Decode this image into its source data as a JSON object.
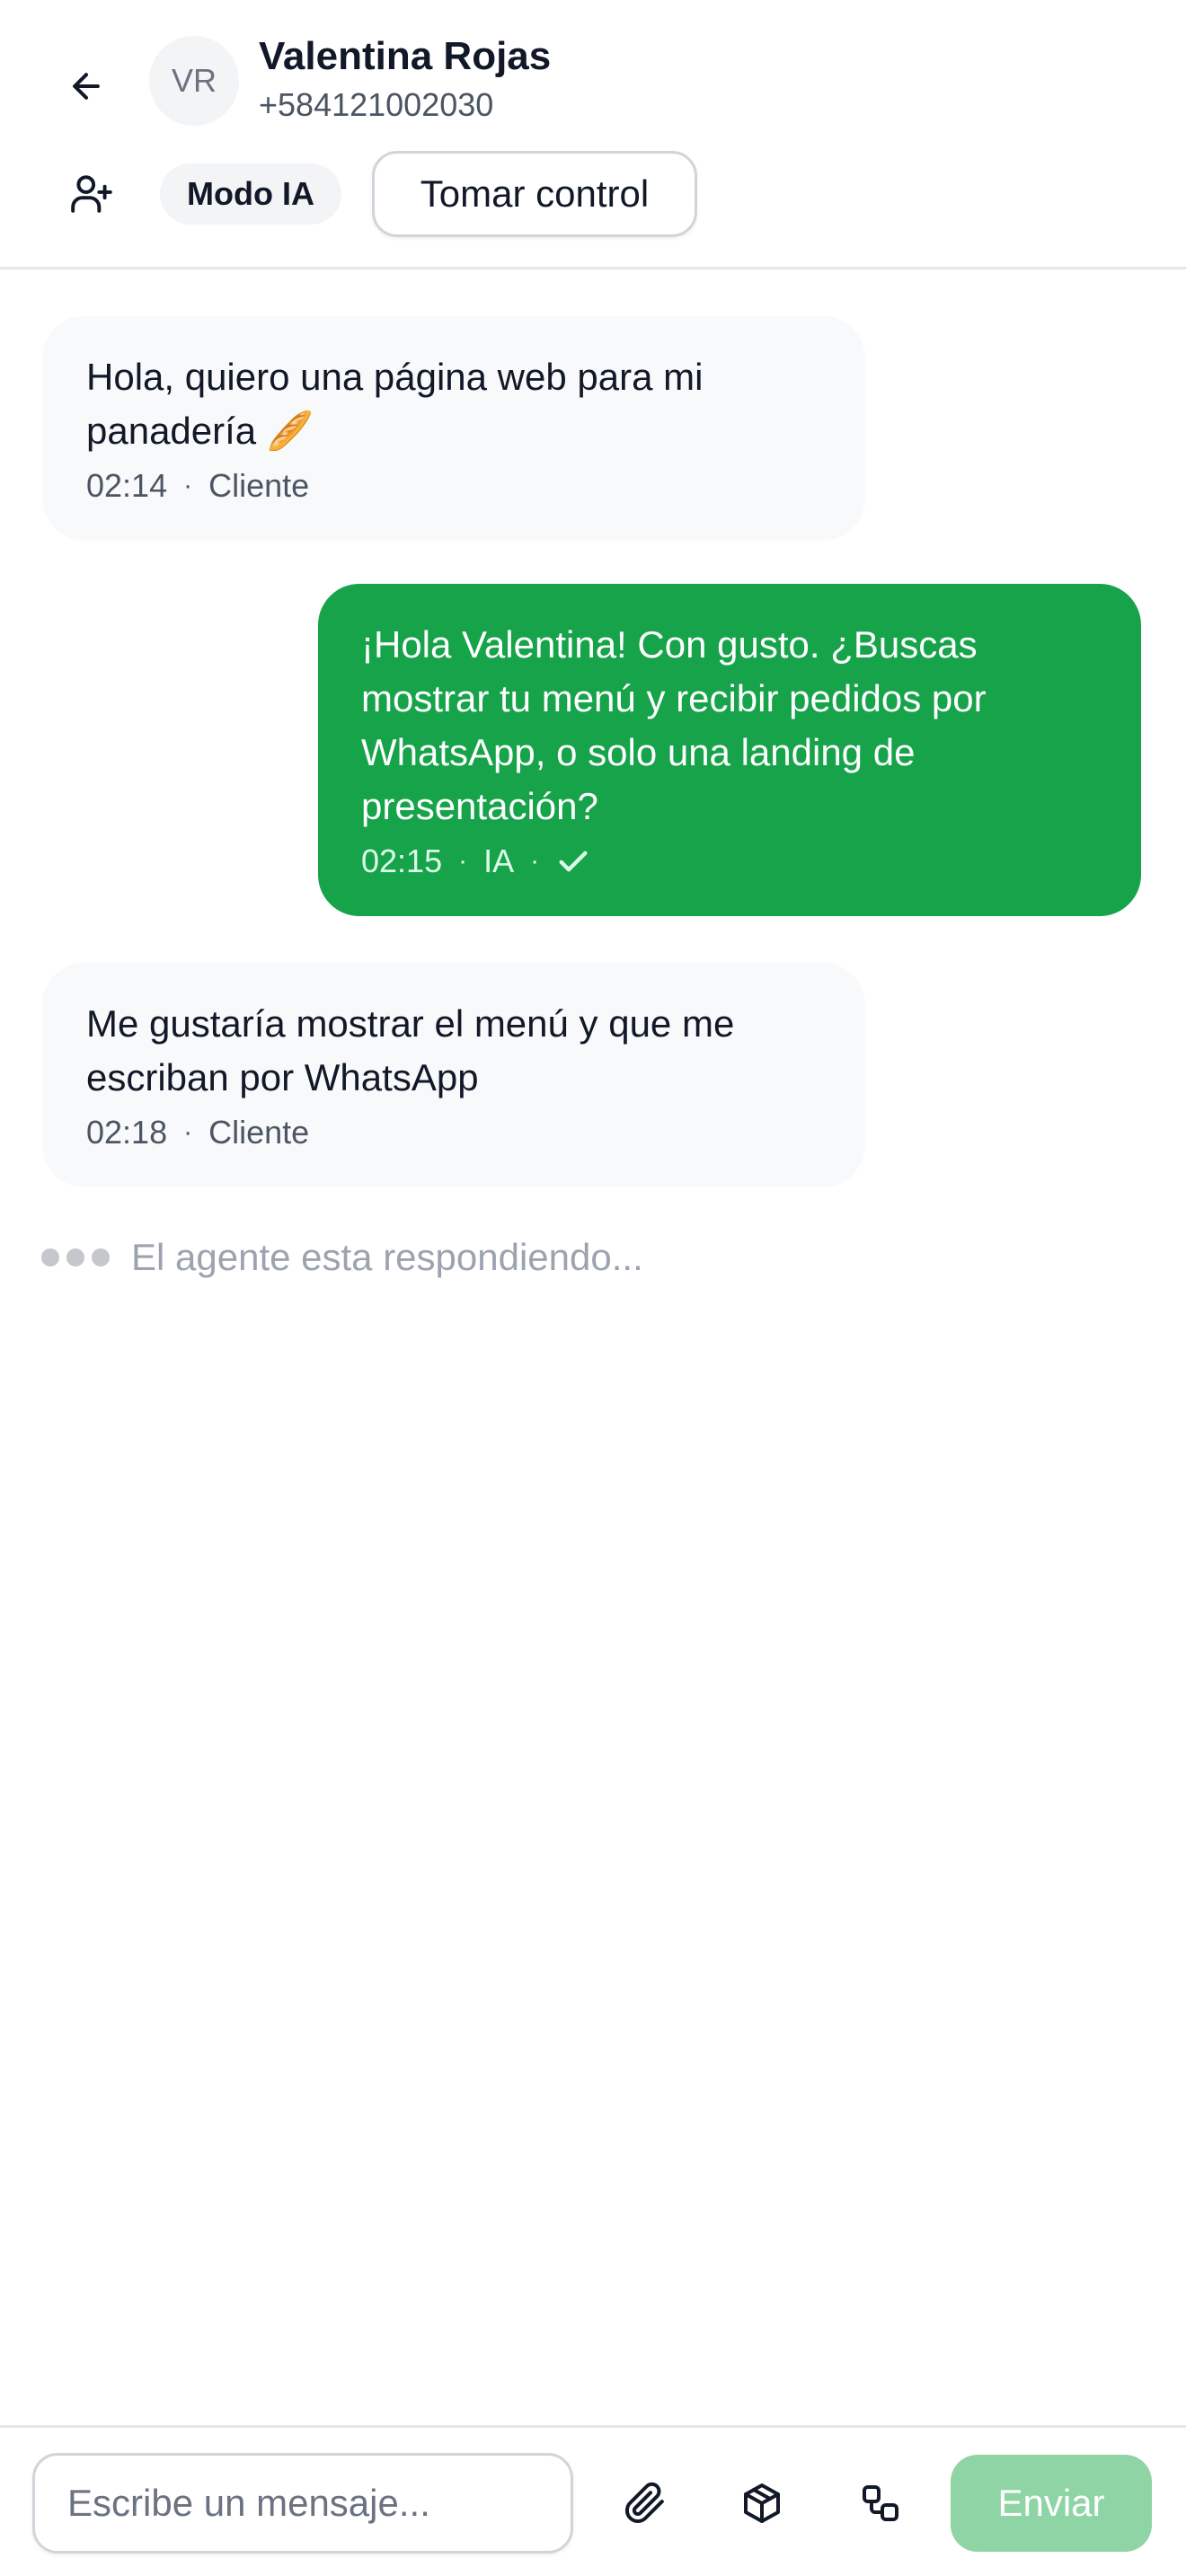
{
  "header": {
    "avatar_initials": "VR",
    "contact_name": "Valentina Rojas",
    "contact_phone": "+584121002030",
    "mode_label": "Modo IA",
    "take_control_label": "Tomar control",
    "icons": {
      "back": "arrow-left-icon",
      "assign": "user-plus-icon"
    }
  },
  "messages": [
    {
      "direction": "incoming",
      "text": "Hola, quiero una página web para mi panadería 🥖",
      "time": "02:14",
      "sender": "Cliente"
    },
    {
      "direction": "outgoing",
      "text": "¡Hola Valentina! Con gusto. ¿Buscas mostrar tu menú y recibir pedidos por WhatsApp, o solo una landing de presentación?",
      "time": "02:15",
      "sender": "IA",
      "status_icon": "check-icon"
    },
    {
      "direction": "incoming",
      "text": "Me gustaría mostrar el menú y que me escriban por WhatsApp",
      "time": "02:18",
      "sender": "Cliente"
    }
  ],
  "meta_separator": "·",
  "typing_indicator": "El agente esta respondiendo...",
  "composer": {
    "placeholder": "Escribe un mensaje...",
    "send_label": "Enviar",
    "icons": [
      "paperclip-icon",
      "package-icon",
      "workflow-icon"
    ]
  },
  "colors": {
    "outgoing_bubble": "#16a34a",
    "incoming_bubble": "#f8f9fb",
    "send_button_disabled": "#8fd4a5"
  }
}
